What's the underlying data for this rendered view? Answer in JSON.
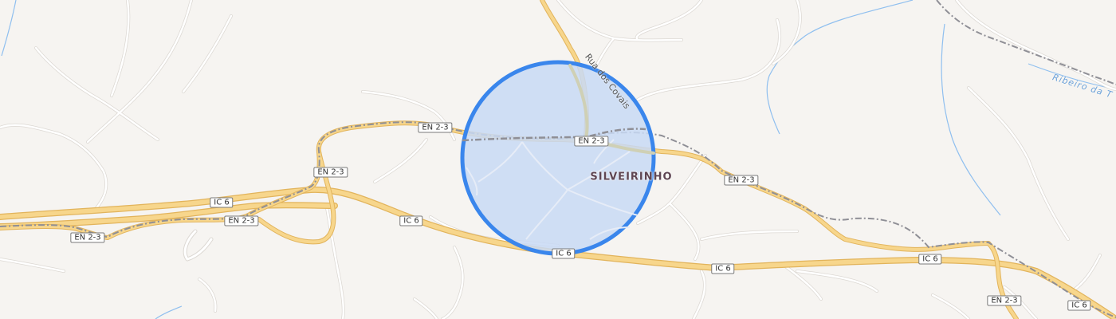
{
  "map": {
    "colors": {
      "background": "#f6f4f1",
      "minor_road": "#ffffff",
      "minor_road_casing": "#dcd8d3",
      "highway_fill": "#f7d68c",
      "highway_casing": "#e2b45c",
      "railway": "#8f8f96",
      "water": "#8fbfef",
      "selection_fill": "#c8d9f5",
      "selection_stroke": "#3a86ec",
      "residential_road_in_circle": "#cfd0b5"
    },
    "place_label": "SILVEIRINHO",
    "street_label": "Rua dos Covais",
    "water_label": "Ribeiro da T",
    "road_labels": {
      "en23_1": "EN 2-3",
      "en23_2": "EN 2-3",
      "en23_3": "EN 2-3",
      "en23_4": "EN 2-3",
      "en23_5": "EN 2-3",
      "en23_6": "EN 2-3",
      "en23_7": "EN 2-3",
      "ic6_1": "IC 6",
      "ic6_2": "IC 6",
      "ic6_3": "IC 6",
      "ic6_4": "IC 6",
      "ic6_5": "IC 6",
      "ic6_6": "IC 6"
    },
    "selection_area": {
      "shape": "circle",
      "center_place": "SILVEIRINHO"
    }
  }
}
